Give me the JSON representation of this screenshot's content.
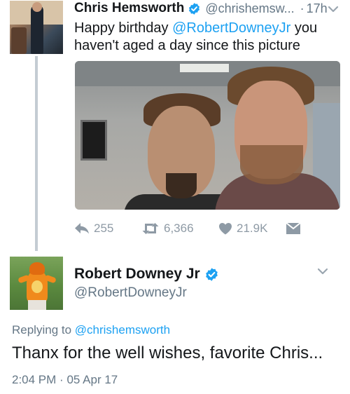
{
  "parent_tweet": {
    "author_name": "Chris Hemsworth",
    "handle": "@chrishemsw...",
    "separator": "·",
    "time": "17h",
    "text_prefix": "Happy birthday ",
    "mention": "@RobertDowneyJr",
    "text_suffix": "  you haven't aged a day since this picture",
    "actions": {
      "replies": "255",
      "retweets": "6,366",
      "likes": "21.9K"
    }
  },
  "reply_tweet": {
    "author_name": "Robert Downey Jr",
    "handle": "@RobertDowneyJr",
    "replying_prefix": "Replying to ",
    "replying_to": "@chrishemsworth",
    "text": "Thanx for the well wishes, favorite Chris...",
    "time": "2:04 PM",
    "separator": "·",
    "date": "05 Apr 17"
  },
  "colors": {
    "link": "#1da1f2",
    "secondary_text": "#657786",
    "action_icon": "#8e9aa5",
    "thread_line": "#c4ccd3"
  },
  "icons": [
    "verified-badge-icon",
    "chevron-down-icon",
    "reply-icon",
    "retweet-icon",
    "like-heart-icon",
    "direct-message-icon"
  ]
}
